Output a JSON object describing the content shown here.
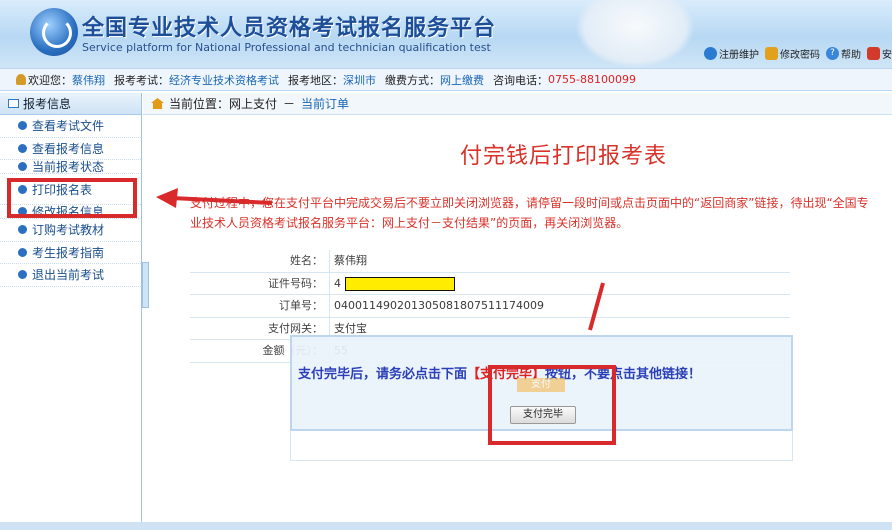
{
  "header": {
    "title_cn": "全国专业技术人员资格考试报名服务平台",
    "title_en": "Service platform for National Professional and technician qualification test",
    "links": [
      {
        "icon": "globe-icon",
        "label": "注册维护"
      },
      {
        "icon": "lock-icon",
        "label": "修改密码"
      },
      {
        "icon": "help-icon",
        "label": "帮助"
      },
      {
        "icon": "exit-icon",
        "label": "安"
      }
    ]
  },
  "infobar": {
    "welcome_label": "欢迎您：",
    "user": "蔡伟翔",
    "exam_label": "报考考试：",
    "exam": "经济专业技术资格考试",
    "region_label": "报考地区：",
    "region": "深圳市",
    "pay_label": "缴费方式：",
    "pay": "网上缴费",
    "phone_label": "咨询电话：",
    "phone": "0755-88100099"
  },
  "sidebar": {
    "title": "报考信息",
    "items": [
      {
        "label": "查看考试文件"
      },
      {
        "label": "查看报考信息"
      },
      {
        "label": "当前报考状态"
      },
      {
        "label": "打印报名表"
      },
      {
        "label": "修改报名信息"
      },
      {
        "label": "订购考试教材"
      },
      {
        "label": "考生报考指南"
      },
      {
        "label": "退出当前考试"
      }
    ]
  },
  "breadcrumb": {
    "prefix": "当前位置：网上支付",
    "sep": "－",
    "current": "当前订单"
  },
  "main": {
    "title": "付完钱后打印报考表",
    "warning": "支付过程中，您在支付平台中完成交易后不要立即关闭浏览器，请停留一段时间或点击页面中的“返回商家”链接，待出现“全国专业技术人员资格考试报名服务平台：网上支付－支付结果”的页面，再关闭浏览器。",
    "rows": [
      {
        "label": "姓名：",
        "value": "蔡伟翔"
      },
      {
        "label": "证件号码：",
        "value": "4"
      },
      {
        "label": "订单号：",
        "value": "040011490201305081807511174009"
      },
      {
        "label": "支付网关：",
        "value": "支付宝"
      },
      {
        "label": "金额（元）：",
        "value": "55"
      }
    ]
  },
  "popup": {
    "msg_a": "支付完毕后，请务必点击下面",
    "msg_b": "【支付完毕】",
    "msg_c": "按钮，不要点击其他链接！",
    "ghost_button": "支付",
    "done_button": "支付完毕"
  },
  "colors": {
    "accent": "#1a66b3",
    "warning": "#d9322a",
    "annotation": "#d82a2a"
  }
}
